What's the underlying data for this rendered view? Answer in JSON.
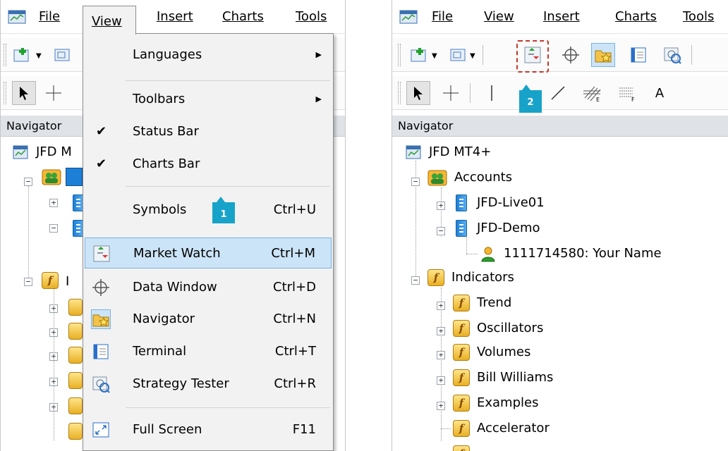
{
  "menubar": {
    "file": "File",
    "view": "View",
    "insert": "Insert",
    "charts": "Charts",
    "tools": "Tools"
  },
  "view_menu": {
    "items": [
      {
        "label": "Languages",
        "shortcut": "",
        "submenu": true
      },
      {
        "label": "Toolbars",
        "shortcut": "",
        "submenu": true
      },
      {
        "label": "Status Bar",
        "shortcut": "",
        "checked": true
      },
      {
        "label": "Charts Bar",
        "shortcut": "",
        "checked": true
      },
      {
        "label": "Symbols",
        "shortcut": "Ctrl+U"
      },
      {
        "label": "Market Watch",
        "shortcut": "Ctrl+M",
        "highlighted": true
      },
      {
        "label": "Data Window",
        "shortcut": "Ctrl+D"
      },
      {
        "label": "Navigator",
        "shortcut": "Ctrl+N"
      },
      {
        "label": "Terminal",
        "shortcut": "Ctrl+T"
      },
      {
        "label": "Strategy Tester",
        "shortcut": "Ctrl+R"
      },
      {
        "label": "Full Screen",
        "shortcut": "F11"
      }
    ]
  },
  "navigator": {
    "header": "Navigator",
    "root": "JFD MT4+",
    "left_root_partial": "JFD M",
    "accounts": "Accounts",
    "live": "JFD-Live01",
    "demo": "JFD-Demo",
    "account_entry": "1111714580: Your Name",
    "indicators": "Indicators",
    "left_indicators_partial": "I",
    "categories": [
      "Trend",
      "Oscillators",
      "Volumes",
      "Bill Williams",
      "Examples",
      "Accelerator"
    ]
  },
  "toolbar_text": {
    "text_tool": "A"
  },
  "callouts": {
    "step1": "1",
    "step2": "2"
  },
  "colors": {
    "callout": "#17a3c9",
    "highlight": "#cce4f7",
    "dashed_box": "#c0392b"
  }
}
